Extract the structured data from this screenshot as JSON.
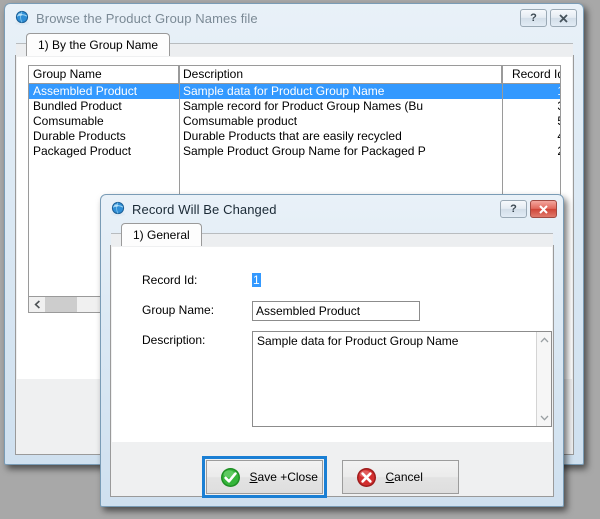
{
  "desktop": {
    "background_color": "#a8a8a8"
  },
  "main_window": {
    "title": "Browse the Product Group Names file",
    "icon": "globe-icon",
    "titlebar_buttons": [
      {
        "name": "help-button",
        "label": "?"
      },
      {
        "name": "close-button",
        "label": "✕"
      }
    ],
    "tabs": [
      {
        "label": "1) By the Group Name",
        "selected": true
      }
    ],
    "grid": {
      "columns": [
        "Group Name",
        "Description",
        "Record Id"
      ],
      "rows": [
        {
          "name": "Assembled Product",
          "description": "Sample data for Product Group Name",
          "id": "1",
          "selected": true
        },
        {
          "name": "Bundled Product",
          "description": "Sample record for Product Group Names (Bu",
          "id": "3",
          "selected": false
        },
        {
          "name": "Comsumable",
          "description": "Comsumable product",
          "id": "5",
          "selected": false
        },
        {
          "name": "Durable Products",
          "description": "Durable Products that are easily recycled",
          "id": "4",
          "selected": false
        },
        {
          "name": "Packaged Product",
          "description": "Sample Product Group Name for Packaged P",
          "id": "2",
          "selected": false
        }
      ],
      "selection_color": "#3399ff",
      "hscrollbar": {
        "left_arrow": "❮",
        "visible": true
      }
    }
  },
  "dialog": {
    "title": "Record Will Be Changed",
    "icon": "globe-icon",
    "titlebar_buttons": [
      {
        "name": "help-button",
        "label": "?"
      },
      {
        "name": "close-button",
        "label": "✕",
        "color": "#cf4436"
      }
    ],
    "tabs": [
      {
        "label": "1) General",
        "selected": true
      }
    ],
    "fields": {
      "record_id": {
        "label": "Record Id:",
        "value": "1",
        "highlighted": true
      },
      "group_name": {
        "label": "Group Name:",
        "value": "Assembled Product",
        "placeholder": ""
      },
      "description": {
        "label": "Description:",
        "value": "Sample data for Product Group Name",
        "placeholder": ""
      }
    },
    "scroll_arrows": {
      "up": "˄",
      "down": "˅"
    },
    "buttons": [
      {
        "name": "save-close-button",
        "accel": "S",
        "label_before": "",
        "label_rest": "ave +Close",
        "icon": "green-check-icon",
        "focused": true
      },
      {
        "name": "cancel-button",
        "accel": "C",
        "label_before": "",
        "label_rest": "ancel",
        "icon": "red-x-icon",
        "focused": false
      }
    ]
  }
}
